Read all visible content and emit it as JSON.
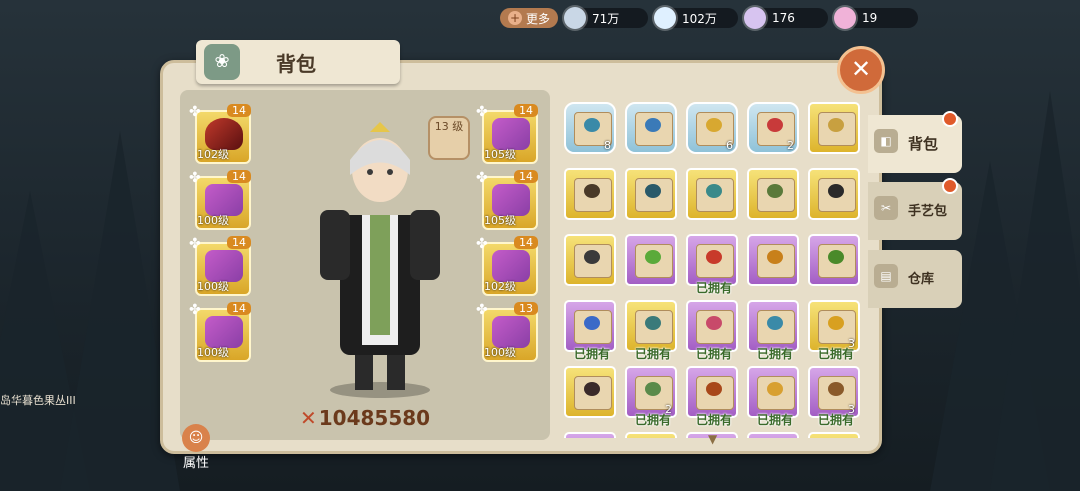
{
  "topbar": {
    "more_label": "更多",
    "currencies": [
      {
        "icon": "gem-icon",
        "value": "71万",
        "color": "#c9d7e6"
      },
      {
        "icon": "flower-icon",
        "value": "102万",
        "color": "#dff0ff"
      },
      {
        "icon": "crystal-icon",
        "value": "176",
        "color": "#d7c4f0"
      },
      {
        "icon": "orb-icon",
        "value": "19",
        "color": "#f0b2d8"
      }
    ]
  },
  "panel": {
    "title": "背包",
    "title_icon": "leaf-emblem-icon",
    "close_label": "✕"
  },
  "character": {
    "level_badge": "13 级",
    "power": "10485580",
    "attr_label": "属性"
  },
  "equipment": {
    "left": [
      {
        "level": "102级",
        "count": "14",
        "kind": "red"
      },
      {
        "level": "100级",
        "count": "14",
        "kind": "purple"
      },
      {
        "level": "100级",
        "count": "14",
        "kind": "purple"
      },
      {
        "level": "100级",
        "count": "14",
        "kind": "purple"
      }
    ],
    "right": [
      {
        "level": "105级",
        "count": "14",
        "kind": "purple"
      },
      {
        "level": "105级",
        "count": "14",
        "kind": "purple"
      },
      {
        "level": "102级",
        "count": "14",
        "kind": "purple"
      },
      {
        "level": "100级",
        "count": "13",
        "kind": "purple"
      }
    ]
  },
  "inventory": {
    "owned_label": "已拥有",
    "rows": [
      [
        {
          "bg": "blue",
          "count": "8",
          "own": false,
          "dot": "#3a8aa8",
          "puzzle": true
        },
        {
          "bg": "blue",
          "count": "",
          "own": false,
          "dot": "#3a7ab8",
          "puzzle": true
        },
        {
          "bg": "blue",
          "count": "6",
          "own": false,
          "dot": "#d8a830",
          "puzzle": true
        },
        {
          "bg": "blue",
          "count": "2",
          "own": false,
          "dot": "#c83a3a",
          "puzzle": true
        },
        {
          "bg": "yellow",
          "count": "",
          "own": false,
          "dot": "#c8a040",
          "puzzle": false
        }
      ],
      [
        {
          "bg": "yellow",
          "count": "",
          "own": false,
          "dot": "#4a3a28"
        },
        {
          "bg": "yellow",
          "count": "",
          "own": false,
          "dot": "#2a5a6a"
        },
        {
          "bg": "yellow",
          "count": "",
          "own": false,
          "dot": "#3a8a8a"
        },
        {
          "bg": "yellow",
          "count": "",
          "own": false,
          "dot": "#5a7a3a"
        },
        {
          "bg": "yellow",
          "count": "",
          "own": false,
          "dot": "#2a2a2a"
        }
      ],
      [
        {
          "bg": "yellow",
          "count": "",
          "own": false,
          "dot": "#3a3a3a"
        },
        {
          "bg": "purple",
          "count": "",
          "own": false,
          "dot": "#5aaa3a"
        },
        {
          "bg": "purple",
          "count": "",
          "own": true,
          "dot": "#c83a2a"
        },
        {
          "bg": "purple",
          "count": "",
          "own": false,
          "dot": "#c8801a"
        },
        {
          "bg": "purple",
          "count": "",
          "own": false,
          "dot": "#4a8a2a"
        }
      ],
      [
        {
          "bg": "purple",
          "count": "",
          "own": true,
          "dot": "#3a6ac8"
        },
        {
          "bg": "yellow",
          "count": "",
          "own": true,
          "dot": "#3a7a7a"
        },
        {
          "bg": "purple",
          "count": "",
          "own": true,
          "dot": "#c84a6a"
        },
        {
          "bg": "purple",
          "count": "",
          "own": true,
          "dot": "#3a8aa8"
        },
        {
          "bg": "yellow",
          "count": "3",
          "own": true,
          "dot": "#d8a020"
        }
      ],
      [
        {
          "bg": "yellow",
          "count": "",
          "own": false,
          "dot": "#3a2a2a"
        },
        {
          "bg": "purple",
          "count": "2",
          "own": true,
          "dot": "#5a8a4a"
        },
        {
          "bg": "purple",
          "count": "",
          "own": true,
          "dot": "#a8481a"
        },
        {
          "bg": "purple",
          "count": "",
          "own": true,
          "dot": "#d8a030"
        },
        {
          "bg": "purple",
          "count": "3",
          "own": true,
          "dot": "#8a5a2a"
        }
      ],
      [
        {
          "bg": "purple",
          "count": "",
          "own": true,
          "dot": "#3a6ac8"
        },
        {
          "bg": "yellow",
          "count": "",
          "own": true,
          "dot": "#3a7a7a"
        },
        {
          "bg": "purple",
          "count": "",
          "own": true,
          "dot": "#c84a6a"
        },
        {
          "bg": "purple",
          "count": "",
          "own": true,
          "dot": "#3a8aa8"
        },
        {
          "bg": "yellow",
          "count": "",
          "own": true,
          "dot": "#d8a020"
        }
      ]
    ]
  },
  "tabs": [
    {
      "label": "背包",
      "icon": "bag-icon",
      "active": true
    },
    {
      "label": "手艺包",
      "icon": "craft-icon",
      "active": false
    },
    {
      "label": "仓库",
      "icon": "warehouse-icon",
      "active": false
    }
  ],
  "map_text": "岛华暮色果丛III"
}
